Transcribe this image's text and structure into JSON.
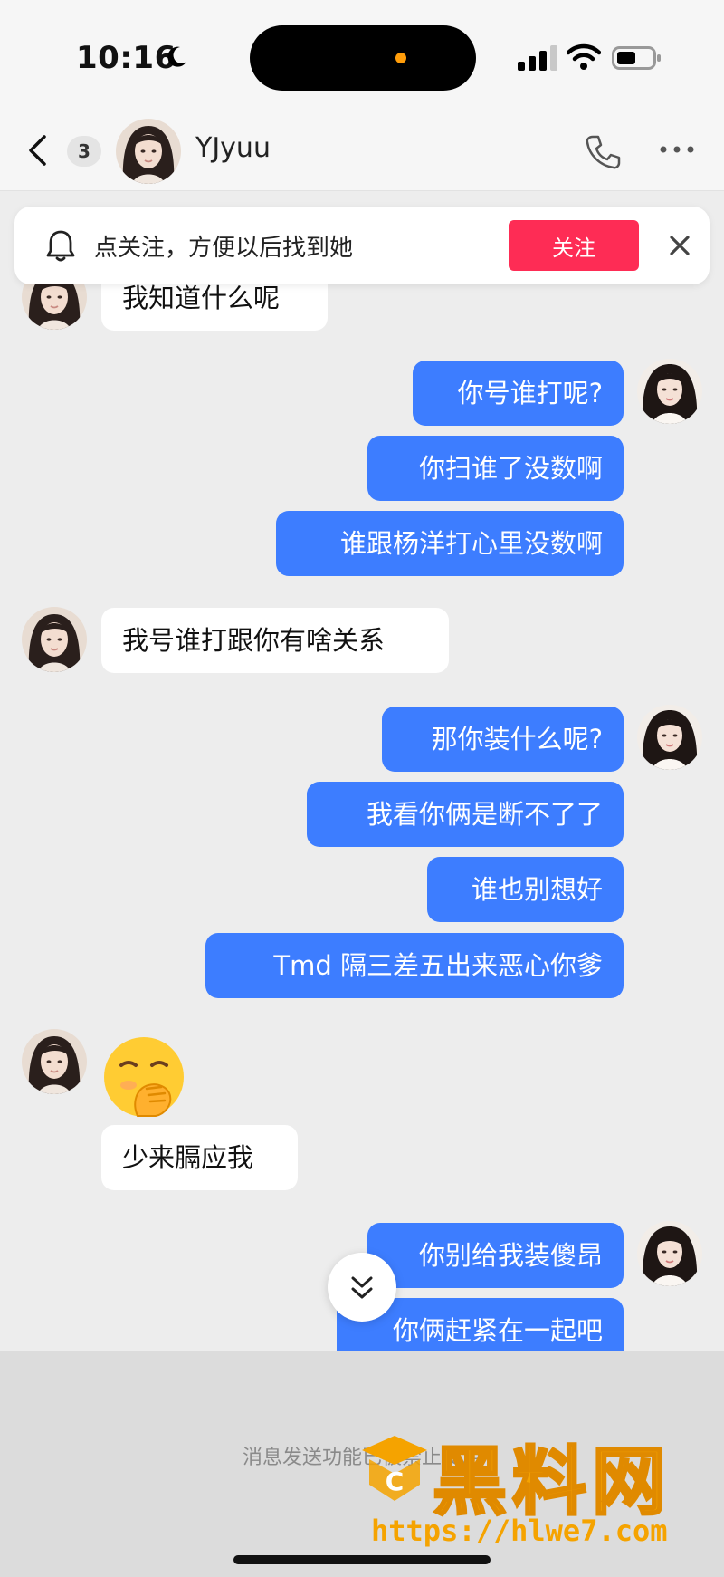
{
  "status_bar": {
    "time": "10:16"
  },
  "header": {
    "unread_count": "3",
    "contact_name": "YJyuu"
  },
  "follow_banner": {
    "text": "点关注，方便以后找到她",
    "button_label": "关注"
  },
  "messages": [
    {
      "side": "in",
      "text": "我知道什么呢"
    },
    {
      "side": "out",
      "text": "你号谁打呢?"
    },
    {
      "side": "out",
      "text": "你扫谁了没数啊"
    },
    {
      "side": "out",
      "text": "谁跟杨洋打心里没数啊"
    },
    {
      "side": "in",
      "text": "我号谁打跟你有啥关系"
    },
    {
      "side": "out",
      "text": "那你装什么呢?"
    },
    {
      "side": "out",
      "text": "我看你俩是断不了了"
    },
    {
      "side": "out",
      "text": "谁也别想好"
    },
    {
      "side": "out",
      "text": "Tmd 隔三差五出来恶心你爹"
    },
    {
      "side": "in",
      "emoji": "hand-over-mouth-emoji"
    },
    {
      "side": "in",
      "text": "少来膈应我"
    },
    {
      "side": "out",
      "text": "你别给我装傻昂"
    },
    {
      "side": "out",
      "text": "你俩赶紧在一起吧"
    }
  ],
  "footer": {
    "disabled_notice": "消息发送功能已被禁止使用",
    "watermark_text": "黑料网",
    "watermark_url": "https://hlwe7.com"
  },
  "colors": {
    "outgoing_bubble": "#3d7dff",
    "incoming_bubble": "#ffffff",
    "follow_button": "#fe2c55",
    "background": "#ededed",
    "watermark": "#f5a300"
  },
  "icons": [
    "back-chevron-icon",
    "moon-icon",
    "signal-icon",
    "wifi-icon",
    "battery-icon",
    "phone-icon",
    "more-icon",
    "bell-icon",
    "close-icon",
    "scroll-down-icon"
  ]
}
